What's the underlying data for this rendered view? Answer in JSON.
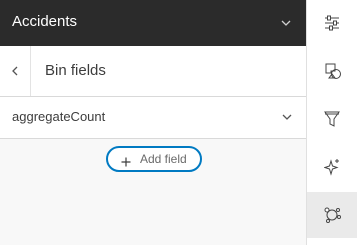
{
  "header": {
    "title": "Accidents"
  },
  "subheader": {
    "title": "Bin fields"
  },
  "field": {
    "label": "aggregateCount"
  },
  "add_field": {
    "label": "Add field"
  },
  "toolbar": {
    "items": [
      {
        "icon": "sliders-icon"
      },
      {
        "icon": "shapes-icon"
      },
      {
        "icon": "filter-icon"
      },
      {
        "icon": "sparkle-icon"
      },
      {
        "icon": "clustering-icon",
        "active": true
      }
    ]
  },
  "colors": {
    "header_bg": "#2b2b2b",
    "accent": "#007ac2",
    "panel_bg": "#f8f8f8"
  }
}
